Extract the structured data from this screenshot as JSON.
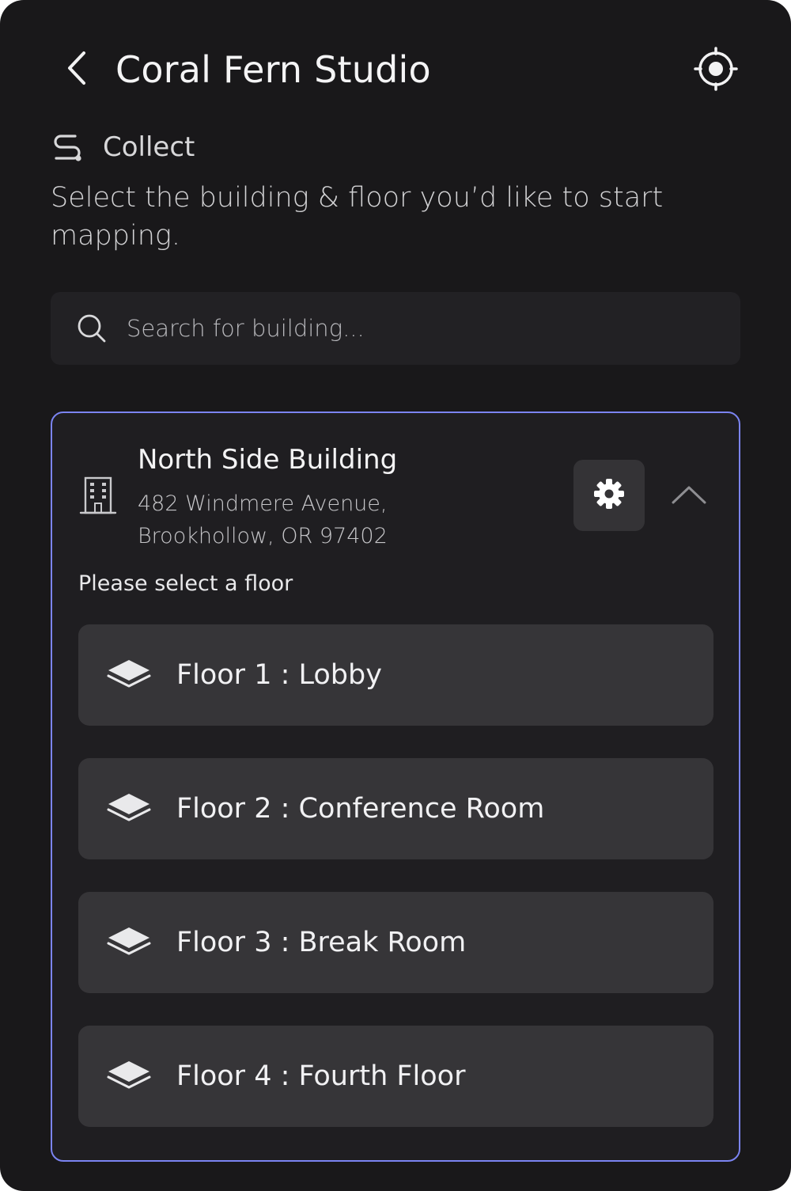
{
  "header": {
    "title": "Coral Fern Studio",
    "back_icon": "chevron-left-icon",
    "locate_icon": "crosshair-target-icon"
  },
  "mode": {
    "icon": "route-path-icon",
    "label": "Collect"
  },
  "instruction": "Select the building & floor you’d like to start mapping.",
  "search": {
    "placeholder": "Search for building...",
    "value": "",
    "icon": "search-icon"
  },
  "building": {
    "icon": "building-icon",
    "name": "North Side Building",
    "address_line1": "482 Windmere Avenue,",
    "address_line2": "Brookhollow, OR 97402",
    "settings_icon": "gear-icon",
    "collapse_icon": "chevron-up-icon",
    "floor_prompt": "Please select a floor",
    "floors": [
      {
        "label": "Floor 1 : Lobby",
        "icon": "layers-icon"
      },
      {
        "label": "Floor 2 : Conference Room",
        "icon": "layers-icon"
      },
      {
        "label": "Floor 3 : Break Room",
        "icon": "layers-icon"
      },
      {
        "label": "Floor 4 : Fourth Floor",
        "icon": "layers-icon"
      }
    ]
  },
  "colors": {
    "background": "#19181a",
    "card_border": "#7b84f2",
    "floor_item": "#363538",
    "search_bg": "#222124"
  }
}
